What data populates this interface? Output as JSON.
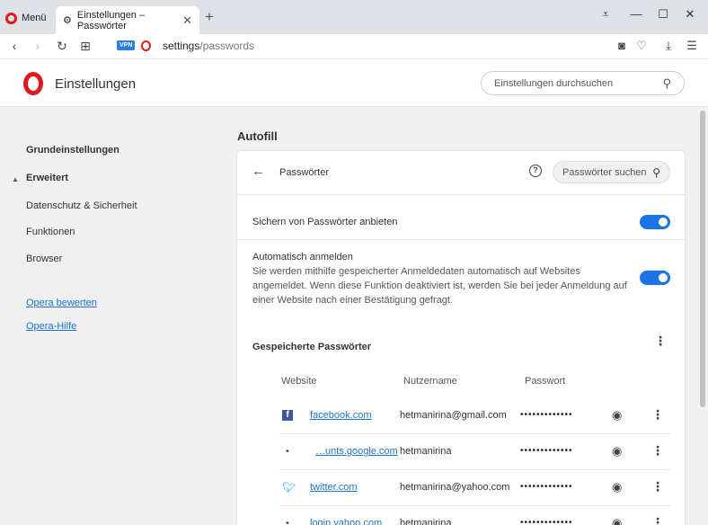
{
  "titlebar": {
    "menu_label": "Menü",
    "tab_title": "Einstellungen – Passwörter",
    "tab_close": "✕",
    "new_tab": "+"
  },
  "addressbar": {
    "vpn_badge": "VPN",
    "url_host": "settings",
    "url_path": "/passwords"
  },
  "header": {
    "title": "Einstellungen",
    "search_placeholder": "Einstellungen durchsuchen"
  },
  "sidebar": {
    "basic": "Grundeinstellungen",
    "advanced": "Erweitert",
    "items": [
      "Datenschutz & Sicherheit",
      "Funktionen",
      "Browser"
    ],
    "link_rate": "Opera bewerten",
    "link_help": "Opera-Hilfe"
  },
  "main": {
    "section_title": "Autofill",
    "card_title": "Passwörter",
    "search_placeholder": "Passwörter suchen",
    "offer_label": "Sichern von Passwörter anbieten",
    "auto_signin_label": "Automatisch anmelden",
    "auto_signin_desc": "Sie werden mithilfe gespeicherter Anmeldedaten automatisch auf Websites angemeldet. Wenn diese Funktion deaktiviert ist, werden Sie bei jeder Anmeldung auf einer Website nach einer Bestätigung gefragt.",
    "saved_title": "Gespeicherte Passwörter",
    "col_website": "Website",
    "col_user": "Nutzername",
    "col_password": "Passwort",
    "passwords": [
      {
        "site": "facebook.com",
        "user": "hetmanirina@gmail.com",
        "password": "•••••••••••••",
        "icon": "facebook-icon"
      },
      {
        "site": "…unts.google.com",
        "user": "hetmanirina",
        "password": "•••••••••••••",
        "icon": "document-icon"
      },
      {
        "site": "twitter.com",
        "user": "hetmanirina@yahoo.com",
        "password": "•••••••••••••",
        "icon": "twitter-icon"
      },
      {
        "site": "login.yahoo.com",
        "user": "hetmanirina",
        "password": "•••••••••••••",
        "icon": "document-icon"
      }
    ]
  },
  "colors": {
    "accent": "#1a73e8",
    "link": "#1a73c9",
    "opera_red": "#e0191f",
    "background": "#f0f0f0"
  }
}
